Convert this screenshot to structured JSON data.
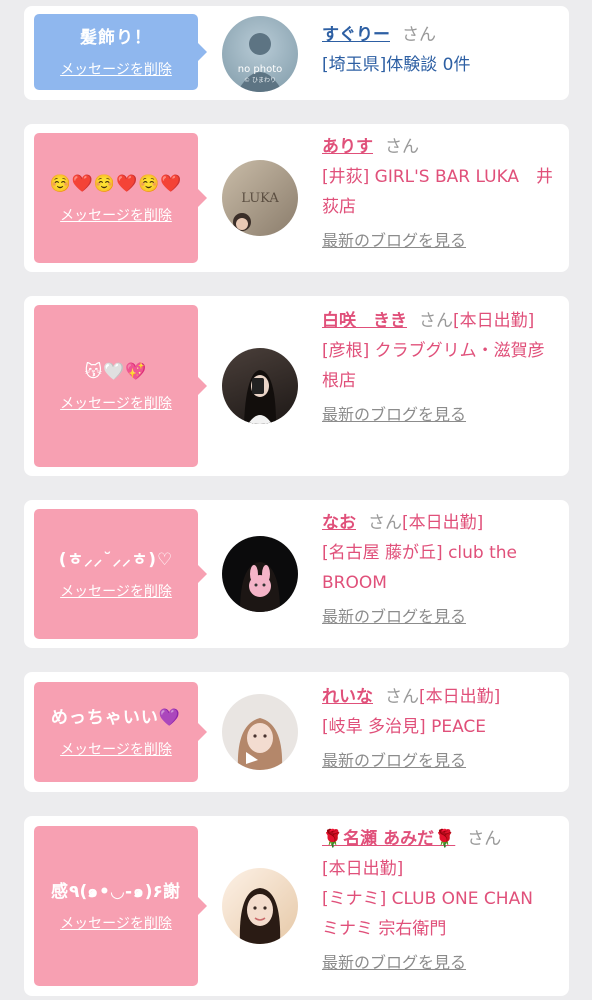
{
  "messages": [
    {
      "text": "髪飾り！",
      "delete": "メッセージを削除",
      "name": "すぐりー",
      "san": "さん",
      "status": "",
      "shop": "[埼玉県]体験談 0件",
      "blog": ""
    },
    {
      "text": "☺️❤️☺️❤️☺️❤️",
      "delete": "メッセージを削除",
      "name": "ありす",
      "san": "さん",
      "status": "",
      "shop": "[井荻] GIRL'S BAR LUKA　井荻店",
      "blog": "最新のブログを見る"
    },
    {
      "text": "😽🤍💖",
      "delete": "メッセージを削除",
      "name": "白咲　きき",
      "san": "さん",
      "status": "[本日出勤]",
      "shop": "[彦根] クラブグリム・滋賀彦根店",
      "blog": "最新のブログを見る"
    },
    {
      "text": "(ㅎ⸝⸝˘⸝⸝ㅎ)♡",
      "delete": "メッセージを削除",
      "name": "なお",
      "san": "さん",
      "status": "[本日出勤]",
      "shop": "[名古屋 藤が丘] club the BROOM",
      "blog": "最新のブログを見る"
    },
    {
      "text": "めっちゃいい💜",
      "delete": "メッセージを削除",
      "name": "れいな",
      "san": "さん",
      "status": "[本日出勤]",
      "shop": "[岐阜 多治見] PEACE",
      "blog": "最新のブログを見る"
    },
    {
      "text": "感٩(๑•◡-๑)۶謝",
      "delete": "メッセージを削除",
      "name": "🌹名瀬 あみだ🌹",
      "san": "さん",
      "status": "[本日出勤]",
      "shop": "[ミナミ] CLUB ONE CHAN ミナミ 宗右衛門",
      "blog": "最新のブログを見る"
    }
  ],
  "avatars": [
    {
      "caption": "no photo",
      "sub": "© ひまわり"
    },
    {
      "caption": "LUKA"
    },
    {},
    {},
    {},
    {}
  ]
}
